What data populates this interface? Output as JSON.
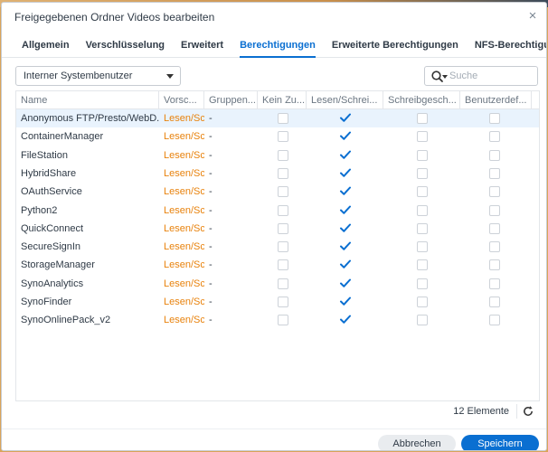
{
  "dialog": {
    "title": "Freigegebenen Ordner Videos bearbeiten",
    "close_glyph": "×"
  },
  "tabs": [
    {
      "label": "Allgemein",
      "active": false
    },
    {
      "label": "Verschlüsselung",
      "active": false
    },
    {
      "label": "Erweitert",
      "active": false
    },
    {
      "label": "Berechtigungen",
      "active": true
    },
    {
      "label": "Erweiterte Berechtigungen",
      "active": false
    },
    {
      "label": "NFS-Berechtigungen",
      "active": false
    }
  ],
  "toolbar": {
    "user_type_select": "Interner Systembenutzer",
    "search_placeholder": "Suche"
  },
  "table": {
    "columns": [
      "Name",
      "Vorsc...",
      "Gruppen...",
      "Kein Zu...",
      "Lesen/Schrei...",
      "Schreibgesch...",
      "Benutzerdef..."
    ],
    "rows": [
      {
        "name": "Anonymous FTP/Presto/WebD...",
        "preview": "Lesen/Sc",
        "group": "-",
        "no_access": false,
        "read_write": true,
        "read_only": false,
        "custom": false,
        "selected": true
      },
      {
        "name": "ContainerManager",
        "preview": "Lesen/Sc",
        "group": "-",
        "no_access": false,
        "read_write": true,
        "read_only": false,
        "custom": false,
        "selected": false
      },
      {
        "name": "FileStation",
        "preview": "Lesen/Sc",
        "group": "-",
        "no_access": false,
        "read_write": true,
        "read_only": false,
        "custom": false,
        "selected": false
      },
      {
        "name": "HybridShare",
        "preview": "Lesen/Sc",
        "group": "-",
        "no_access": false,
        "read_write": true,
        "read_only": false,
        "custom": false,
        "selected": false
      },
      {
        "name": "OAuthService",
        "preview": "Lesen/Sc",
        "group": "-",
        "no_access": false,
        "read_write": true,
        "read_only": false,
        "custom": false,
        "selected": false
      },
      {
        "name": "Python2",
        "preview": "Lesen/Sc",
        "group": "-",
        "no_access": false,
        "read_write": true,
        "read_only": false,
        "custom": false,
        "selected": false
      },
      {
        "name": "QuickConnect",
        "preview": "Lesen/Sc",
        "group": "-",
        "no_access": false,
        "read_write": true,
        "read_only": false,
        "custom": false,
        "selected": false
      },
      {
        "name": "SecureSignIn",
        "preview": "Lesen/Sc",
        "group": "-",
        "no_access": false,
        "read_write": true,
        "read_only": false,
        "custom": false,
        "selected": false
      },
      {
        "name": "StorageManager",
        "preview": "Lesen/Sc",
        "group": "-",
        "no_access": false,
        "read_write": true,
        "read_only": false,
        "custom": false,
        "selected": false
      },
      {
        "name": "SynoAnalytics",
        "preview": "Lesen/Sc",
        "group": "-",
        "no_access": false,
        "read_write": true,
        "read_only": false,
        "custom": false,
        "selected": false
      },
      {
        "name": "SynoFinder",
        "preview": "Lesen/Sc",
        "group": "-",
        "no_access": false,
        "read_write": true,
        "read_only": false,
        "custom": false,
        "selected": false
      },
      {
        "name": "SynoOnlinePack_v2",
        "preview": "Lesen/Sc",
        "group": "-",
        "no_access": false,
        "read_write": true,
        "read_only": false,
        "custom": false,
        "selected": false
      }
    ]
  },
  "footer": {
    "count_label": "12 Elemente",
    "cancel_label": "Abbrechen",
    "save_label": "Speichern"
  },
  "colors": {
    "accent": "#0a6fd1",
    "preview_text": "#e8820c",
    "selected_row": "#e9f3fd"
  },
  "icons": {
    "close": "close-icon",
    "search": "search-icon",
    "dropdown": "chevron-down-icon",
    "refresh": "refresh-icon",
    "check": "check-icon"
  }
}
